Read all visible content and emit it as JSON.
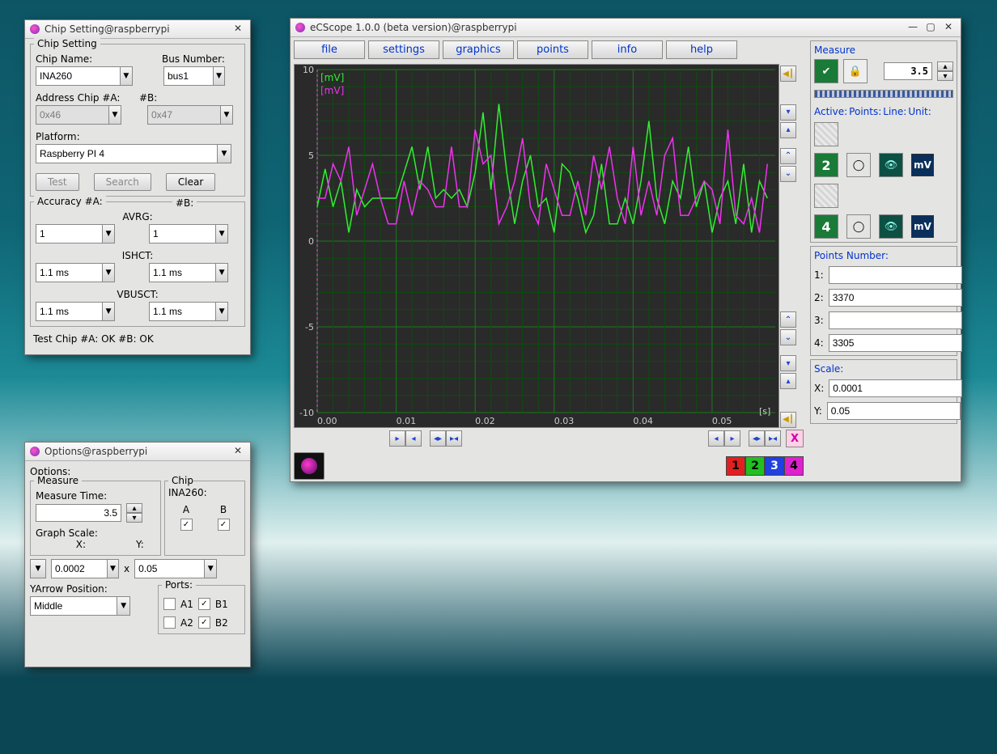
{
  "chip_window": {
    "title": "Chip Setting@raspberrypi",
    "legend": "Chip Setting",
    "chip_name_label": "Chip Name:",
    "chip_name_value": "INA260",
    "bus_label": "Bus Number:",
    "bus_value": "bus1",
    "addr_a_label": "Address Chip #A:",
    "addr_b_label": "#B:",
    "addr_a_value": "0x46",
    "addr_b_value": "0x47",
    "platform_label": "Platform:",
    "platform_value": "Raspberry PI 4",
    "test_btn": "Test",
    "search_btn": "Search",
    "clear_btn": "Clear",
    "acc_a_label": "Accuracy #A:",
    "acc_b_label": "#B:",
    "avrg_label": "AVRG:",
    "avrg_a": "1",
    "avrg_b": "1",
    "ishct_label": "ISHCT:",
    "ishct_a": "1.1 ms",
    "ishct_b": "1.1 ms",
    "vbusct_label": "VBUSCT:",
    "vbusct_a": "1.1 ms",
    "vbusct_b": "1.1 ms",
    "status": "Test Chip #A: OK #B: OK"
  },
  "options_window": {
    "title": "Options@raspberrypi",
    "options_label": "Options:",
    "measure_legend": "Measure",
    "measure_time_label": "Measure Time:",
    "measure_time_value": "3.5",
    "graph_scale_label": "Graph Scale:",
    "x_label": "X:",
    "y_label": "Y:",
    "x_value": "0.0002",
    "xmul": "x",
    "y_value": "0.05",
    "yarrow_label": "YArrow Position:",
    "yarrow_value": "Middle",
    "chip_legend": "Chip INA260:",
    "col_a": "A",
    "col_b": "B",
    "ports_legend": "Ports:",
    "port_a1": "A1",
    "port_b1": "B1",
    "port_a2": "A2",
    "port_b2": "B2"
  },
  "scope_window": {
    "title": "eCScope 1.0.0 (beta version)@raspberrypi",
    "menus": {
      "file": "file",
      "settings": "settings",
      "graphics": "graphics",
      "points": "points",
      "info": "info",
      "help": "help"
    },
    "y_unit_1": "[mV]",
    "y_unit_2": "[mV]",
    "y_ticks": {
      "p10": "10",
      "p5": "5",
      "z": "0",
      "m5": "-5",
      "m10": "-10"
    },
    "x_unit": "[s]",
    "x_ticks": {
      "t0": "0.00",
      "t1": "0.01",
      "t2": "0.02",
      "t3": "0.03",
      "t4": "0.04",
      "t5": "0.05"
    },
    "x_btn": "X",
    "channel_nums": {
      "c1": "1",
      "c2": "2",
      "c3": "3",
      "c4": "4"
    },
    "measure_legend": "Measure",
    "measure_value": "3.5",
    "active_label": "Active:",
    "points_label": "Points:",
    "line_label": "Line:",
    "unit_label": "Unit:",
    "ch2_num": "2",
    "ch4_num": "4",
    "mv": "mV",
    "points_number_legend": "Points Number:",
    "pn1": "1:",
    "pn2": "2:",
    "pn3": "3:",
    "pn4": "4:",
    "pn2_val": "3370",
    "pn4_val": "3305",
    "scale_legend": "Scale:",
    "sx": "X:",
    "sy": "Y:",
    "sx_val": "0.0001",
    "sy_val": "0.05"
  },
  "chart_data": {
    "type": "line",
    "title": "",
    "xlabel": "[s]",
    "ylabel": "[mV]",
    "xlim": [
      0,
      0.058
    ],
    "ylim": [
      -10,
      10
    ],
    "x_ticks": [
      0.0,
      0.01,
      0.02,
      0.03,
      0.04,
      0.05
    ],
    "y_ticks": [
      -10,
      -5,
      0,
      5,
      10
    ],
    "series": [
      {
        "name": "Channel 2",
        "unit": "mV",
        "color": "#33ee33",
        "x": [
          0.0,
          0.001,
          0.002,
          0.003,
          0.004,
          0.005,
          0.006,
          0.007,
          0.008,
          0.009,
          0.01,
          0.011,
          0.012,
          0.013,
          0.014,
          0.015,
          0.016,
          0.017,
          0.018,
          0.019,
          0.02,
          0.021,
          0.022,
          0.023,
          0.024,
          0.025,
          0.026,
          0.027,
          0.028,
          0.029,
          0.03,
          0.031,
          0.032,
          0.033,
          0.034,
          0.035,
          0.036,
          0.037,
          0.038,
          0.039,
          0.04,
          0.041,
          0.042,
          0.043,
          0.044,
          0.045,
          0.046,
          0.047,
          0.048,
          0.049,
          0.05,
          0.051,
          0.052,
          0.053,
          0.054,
          0.055,
          0.056,
          0.057
        ],
        "y": [
          2.0,
          4.2,
          2.0,
          3.5,
          0.5,
          3.0,
          2.0,
          2.5,
          2.5,
          2.5,
          2.5,
          4.0,
          5.5,
          3.0,
          5.5,
          2.5,
          3.0,
          2.5,
          3.0,
          2.0,
          4.0,
          7.5,
          3.0,
          8.0,
          4.0,
          1.0,
          3.5,
          5.0,
          2.0,
          2.5,
          0.5,
          4.5,
          4.0,
          2.5,
          0.5,
          1.5,
          4.5,
          1.0,
          1.0,
          2.5,
          1.0,
          3.5,
          7.0,
          2.5,
          1.0,
          3.5,
          2.5,
          5.5,
          2.0,
          3.5,
          0.5,
          2.5,
          3.5,
          1.0,
          4.5,
          0.5,
          3.5,
          2.5
        ]
      },
      {
        "name": "Channel 4",
        "unit": "mV",
        "color": "#ee33ee",
        "x": [
          0.0,
          0.001,
          0.002,
          0.003,
          0.004,
          0.005,
          0.006,
          0.007,
          0.008,
          0.009,
          0.01,
          0.011,
          0.012,
          0.013,
          0.014,
          0.015,
          0.016,
          0.017,
          0.018,
          0.019,
          0.02,
          0.021,
          0.022,
          0.023,
          0.024,
          0.025,
          0.026,
          0.027,
          0.028,
          0.029,
          0.03,
          0.031,
          0.032,
          0.033,
          0.034,
          0.035,
          0.036,
          0.037,
          0.038,
          0.039,
          0.04,
          0.041,
          0.042,
          0.043,
          0.044,
          0.045,
          0.046,
          0.047,
          0.048,
          0.049,
          0.05,
          0.051,
          0.052,
          0.053,
          0.054,
          0.055,
          0.056,
          0.057
        ],
        "y": [
          2.5,
          2.5,
          4.5,
          3.5,
          5.5,
          1.5,
          3.0,
          4.5,
          2.5,
          1.0,
          1.0,
          3.5,
          1.5,
          3.5,
          3.0,
          2.0,
          2.0,
          5.5,
          2.0,
          2.0,
          6.5,
          4.5,
          5.0,
          1.0,
          2.0,
          3.5,
          6.0,
          2.0,
          1.0,
          4.5,
          3.0,
          1.5,
          1.5,
          3.5,
          1.5,
          5.0,
          3.0,
          5.5,
          2.5,
          1.0,
          5.5,
          1.5,
          3.5,
          1.5,
          5.0,
          6.0,
          1.5,
          1.5,
          2.5,
          3.5,
          3.0,
          1.0,
          6.5,
          1.5,
          1.0,
          2.5,
          0.5,
          4.5
        ]
      }
    ]
  }
}
